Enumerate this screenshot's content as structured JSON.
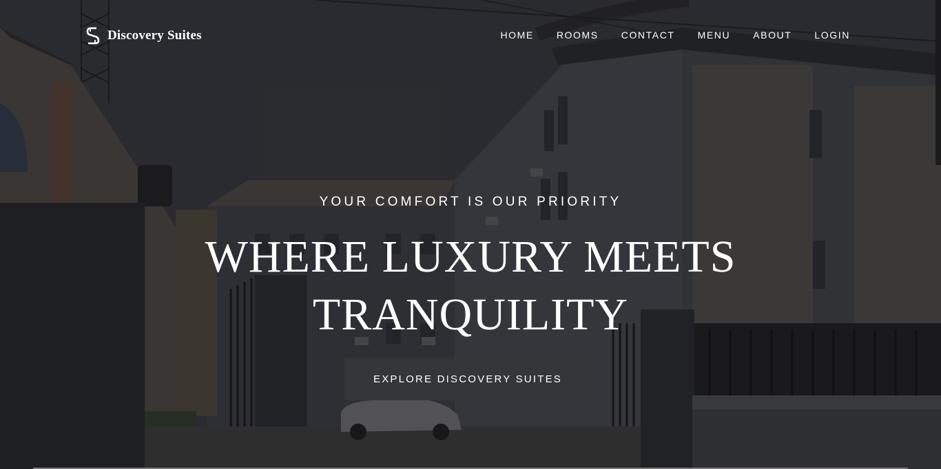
{
  "brand": {
    "name": "Discovery Suites",
    "logo_icon": "s-monogram-icon"
  },
  "nav": {
    "items": [
      {
        "label": "HOME"
      },
      {
        "label": "ROOMS"
      },
      {
        "label": "CONTACT"
      },
      {
        "label": "MENU"
      },
      {
        "label": "ABOUT"
      },
      {
        "label": "LOGIN"
      }
    ]
  },
  "hero": {
    "tagline": "YOUR COMFORT IS OUR PRIORITY",
    "headline_line1": "WHERE LUXURY MEETS",
    "headline_line2": "TRANQUILITY",
    "cta_label": "EXPLORE DISCOVERY SUITES"
  },
  "colors": {
    "text": "#ffffff",
    "button_bg": "#35363a",
    "overlay": "#141416"
  }
}
